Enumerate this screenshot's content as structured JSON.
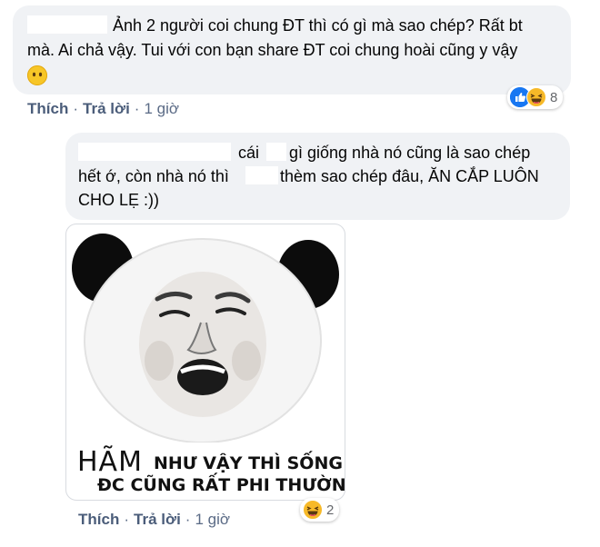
{
  "comment1": {
    "line1": "Ảnh 2 người coi chung ĐT thì có gì mà sao chép? Rất bt",
    "line2": "mà. Ai chả vậy. Tui với con bạn share ĐT coi chung hoài cũng y vậy",
    "reaction_count": "8",
    "reaction_icons": [
      "like-icon",
      "haha-icon"
    ],
    "actions": {
      "like": "Thích",
      "reply": "Trả lời",
      "time": "1 giờ"
    }
  },
  "comment2": {
    "line1_a": "cái",
    "line1_b": "gì giống nhà nó cũng là sao chép",
    "line2_a": "hết ớ, còn nhà nó thì",
    "line2_b": "thèm sao chép đâu, ĂN CẮP LUÔN",
    "line3": "CHO LẸ :))",
    "meme": {
      "caption_big": "HÃM",
      "caption_line1": "NHƯ VẬY THÌ SỐNG",
      "caption_line2": "ĐC CŨNG RẤT PHI THƯỜNG"
    },
    "reaction_count": "2",
    "reaction_icons": [
      "haha-icon"
    ],
    "actions": {
      "like": "Thích",
      "reply": "Trả lời",
      "time": "1 giờ"
    }
  },
  "colors": {
    "bubble": "#f0f2f5",
    "like_blue": "#1877f2",
    "haha_yellow": "#f7b928"
  }
}
